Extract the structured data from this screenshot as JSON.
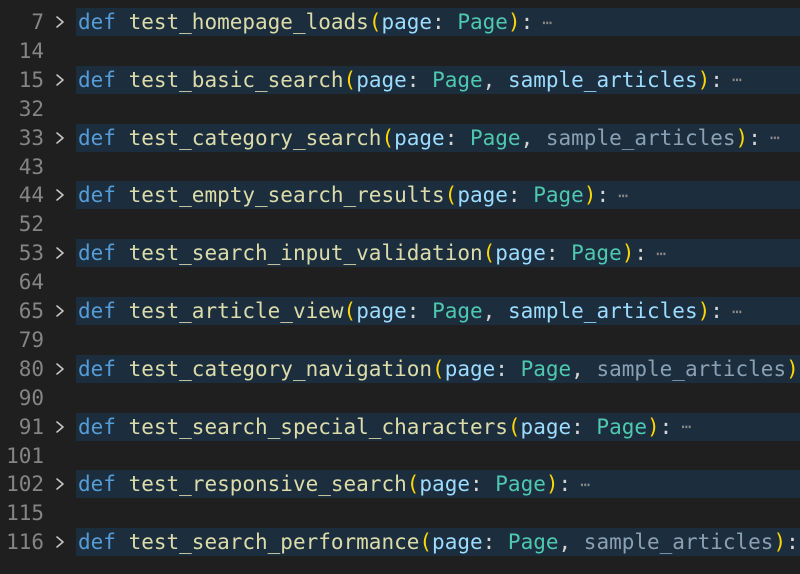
{
  "editor": {
    "keyword": "def",
    "fold_glyph": "chevron-right-icon",
    "ellipsis": "⋯",
    "colors": {
      "background": "#1f1f1f",
      "folded_line_highlight": "#1c2d3d",
      "keyword": "#569cd6",
      "function": "#dcdcaa",
      "parameter": "#9cdcfe",
      "type": "#4ec9b0",
      "paren": "#ffd700"
    },
    "rows": [
      {
        "num": "7",
        "fn": "test_homepage_loads",
        "p1": "page",
        "t1": "Page",
        "p2": ""
      },
      {
        "num": "14"
      },
      {
        "num": "15",
        "fn": "test_basic_search",
        "p1": "page",
        "t1": "Page",
        "p2": "sample_articles"
      },
      {
        "num": "32"
      },
      {
        "num": "33",
        "fn": "test_category_search",
        "p1": "page",
        "t1": "Page",
        "p2": "sample_articles",
        "p2_dim": true
      },
      {
        "num": "43"
      },
      {
        "num": "44",
        "fn": "test_empty_search_results",
        "p1": "page",
        "t1": "Page",
        "p2": ""
      },
      {
        "num": "52"
      },
      {
        "num": "53",
        "fn": "test_search_input_validation",
        "p1": "page",
        "t1": "Page",
        "p2": ""
      },
      {
        "num": "64"
      },
      {
        "num": "65",
        "fn": "test_article_view",
        "p1": "page",
        "t1": "Page",
        "p2": "sample_articles"
      },
      {
        "num": "79"
      },
      {
        "num": "80",
        "fn": "test_category_navigation",
        "p1": "page",
        "t1": "Page",
        "p2": "sample_articles",
        "p2_dim": true
      },
      {
        "num": "90"
      },
      {
        "num": "91",
        "fn": "test_search_special_characters",
        "p1": "page",
        "t1": "Page",
        "p2": ""
      },
      {
        "num": "101"
      },
      {
        "num": "102",
        "fn": "test_responsive_search",
        "p1": "page",
        "t1": "Page",
        "p2": ""
      },
      {
        "num": "115"
      },
      {
        "num": "116",
        "fn": "test_search_performance",
        "p1": "page",
        "t1": "Page",
        "p2": "sample_articles",
        "p2_dim": true
      }
    ]
  }
}
